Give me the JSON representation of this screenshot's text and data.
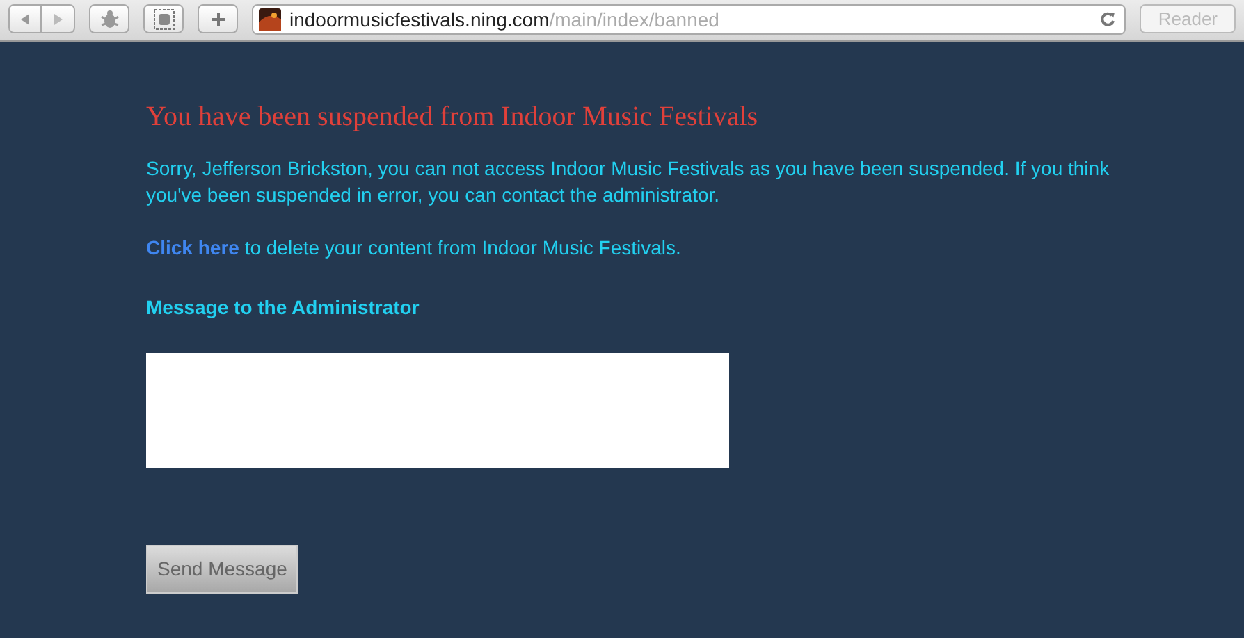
{
  "toolbar": {
    "address": {
      "domain": "indoormusicfestivals.ning.com",
      "path": "/main/index/banned"
    },
    "reader": {
      "label": "Reader",
      "disabled": true
    }
  },
  "page": {
    "title": "You have been suspended from Indoor Music Festivals",
    "message": "Sorry, Jefferson Brickston, you can not access Indoor Music Festivals as you have been suspended. If you think you've been suspended in error, you can contact the administrator.",
    "delete_notice": {
      "link": "Click here",
      "text": " to delete your content from Indoor Music Festivals."
    },
    "form_label": "Message to the Administrator",
    "button": "Send Message"
  }
}
